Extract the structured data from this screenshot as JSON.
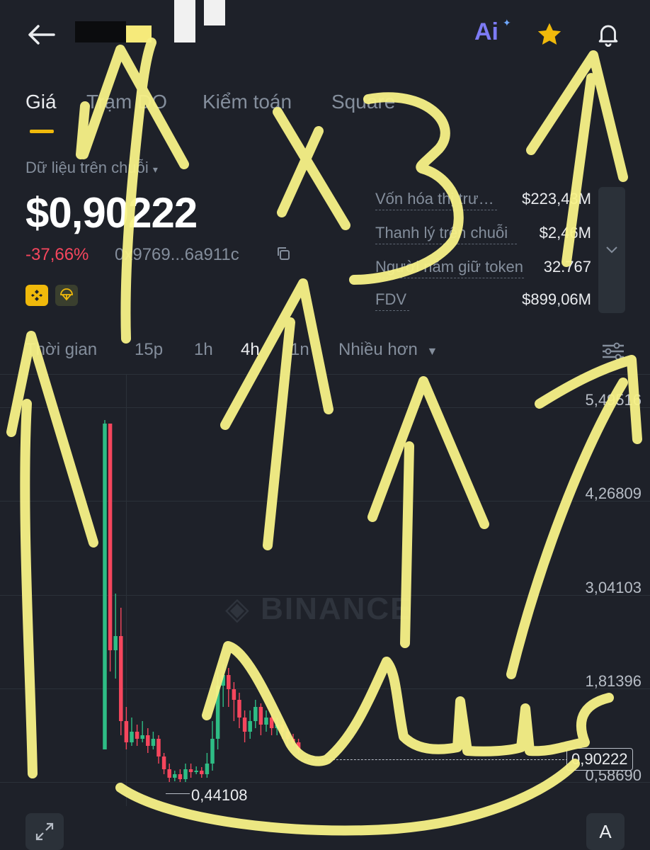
{
  "header": {
    "back_icon": "arrow-left-icon",
    "ai_label": "Ai",
    "star_icon": "star-icon",
    "bell_icon": "bell-icon"
  },
  "tabs": [
    {
      "label": "Giá",
      "active": true
    },
    {
      "label": "Trạm DO",
      "active": false
    },
    {
      "label": "Kiểm toán",
      "active": false
    },
    {
      "label": "Square",
      "active": false
    }
  ],
  "onchain": {
    "label": "Dữ liệu trên chuỗi",
    "price": "$0,90222",
    "change": "-37,66%",
    "address": "0x9769...6a911c",
    "change_color": "#f6465d"
  },
  "stats": [
    {
      "label": "Vốn hóa thị trường",
      "value": "$223,43M"
    },
    {
      "label": "Thanh lý trên chuỗi",
      "value": "$2,46M"
    },
    {
      "label": "Người nắm giữ token",
      "value": "32.767"
    },
    {
      "label": "FDV",
      "value": "$899,06M"
    }
  ],
  "timeframes": [
    {
      "label": "Thời gian",
      "active": false
    },
    {
      "label": "15p",
      "active": false
    },
    {
      "label": "1h",
      "active": false
    },
    {
      "label": "4h",
      "active": true
    },
    {
      "label": "1n",
      "active": false
    },
    {
      "label": "Nhiều hơn",
      "active": false
    }
  ],
  "chart_data": {
    "type": "candlestick",
    "watermark": "BINANCE",
    "y_ticks": [
      "5,49516",
      "4,26809",
      "3,04103",
      "1,81396",
      "0,58690"
    ],
    "current_price_label": "0,90222",
    "low_label": "0,44108",
    "ylim": [
      0.3,
      5.8
    ],
    "colors": {
      "up": "#2ebd85",
      "down": "#f6465d"
    },
    "candles": [
      {
        "o": 0.9,
        "c": 5.5,
        "h": 5.55,
        "l": 0.9
      },
      {
        "o": 5.5,
        "c": 2.3,
        "h": 5.5,
        "l": 2.0
      },
      {
        "o": 2.3,
        "c": 2.5,
        "h": 3.1,
        "l": 1.9
      },
      {
        "o": 2.5,
        "c": 1.3,
        "h": 2.9,
        "l": 1.1
      },
      {
        "o": 1.3,
        "c": 1.0,
        "h": 1.5,
        "l": 0.9
      },
      {
        "o": 1.0,
        "c": 1.15,
        "h": 1.35,
        "l": 0.95
      },
      {
        "o": 1.15,
        "c": 1.05,
        "h": 1.25,
        "l": 0.95
      },
      {
        "o": 1.05,
        "c": 1.1,
        "h": 1.3,
        "l": 1.0
      },
      {
        "o": 1.1,
        "c": 0.95,
        "h": 1.2,
        "l": 0.85
      },
      {
        "o": 0.95,
        "c": 1.05,
        "h": 1.15,
        "l": 0.9
      },
      {
        "o": 1.05,
        "c": 0.8,
        "h": 1.1,
        "l": 0.7
      },
      {
        "o": 0.8,
        "c": 0.62,
        "h": 0.85,
        "l": 0.55
      },
      {
        "o": 0.62,
        "c": 0.5,
        "h": 0.7,
        "l": 0.44
      },
      {
        "o": 0.5,
        "c": 0.55,
        "h": 0.6,
        "l": 0.45
      },
      {
        "o": 0.55,
        "c": 0.48,
        "h": 0.62,
        "l": 0.44
      },
      {
        "o": 0.48,
        "c": 0.62,
        "h": 0.7,
        "l": 0.44
      },
      {
        "o": 0.62,
        "c": 0.58,
        "h": 0.7,
        "l": 0.5
      },
      {
        "o": 0.58,
        "c": 0.6,
        "h": 0.66,
        "l": 0.55
      },
      {
        "o": 0.6,
        "c": 0.55,
        "h": 0.65,
        "l": 0.5
      },
      {
        "o": 0.55,
        "c": 0.7,
        "h": 0.85,
        "l": 0.5
      },
      {
        "o": 0.7,
        "c": 1.05,
        "h": 1.3,
        "l": 0.6
      },
      {
        "o": 1.05,
        "c": 1.8,
        "h": 2.0,
        "l": 0.9
      },
      {
        "o": 1.8,
        "c": 1.95,
        "h": 2.1,
        "l": 1.5
      },
      {
        "o": 1.95,
        "c": 1.75,
        "h": 2.05,
        "l": 1.5
      },
      {
        "o": 1.75,
        "c": 1.6,
        "h": 1.85,
        "l": 1.3
      },
      {
        "o": 1.6,
        "c": 1.35,
        "h": 1.7,
        "l": 1.2
      },
      {
        "o": 1.35,
        "c": 1.15,
        "h": 1.45,
        "l": 1.0
      },
      {
        "o": 1.15,
        "c": 1.3,
        "h": 1.45,
        "l": 1.05
      },
      {
        "o": 1.3,
        "c": 1.5,
        "h": 1.6,
        "l": 1.2
      },
      {
        "o": 1.5,
        "c": 1.25,
        "h": 1.55,
        "l": 1.1
      },
      {
        "o": 1.25,
        "c": 1.35,
        "h": 1.45,
        "l": 1.15
      },
      {
        "o": 1.35,
        "c": 1.2,
        "h": 1.4,
        "l": 1.1
      },
      {
        "o": 1.2,
        "c": 1.25,
        "h": 1.35,
        "l": 1.1
      },
      {
        "o": 1.25,
        "c": 1.15,
        "h": 1.3,
        "l": 1.05
      },
      {
        "o": 1.15,
        "c": 1.05,
        "h": 1.2,
        "l": 0.95
      },
      {
        "o": 1.05,
        "c": 1.0,
        "h": 1.12,
        "l": 0.95
      },
      {
        "o": 1.0,
        "c": 0.9,
        "h": 1.05,
        "l": 0.85
      }
    ]
  },
  "footer": {
    "expand_icon": "expand-icon",
    "auto_scale_label": "A"
  }
}
